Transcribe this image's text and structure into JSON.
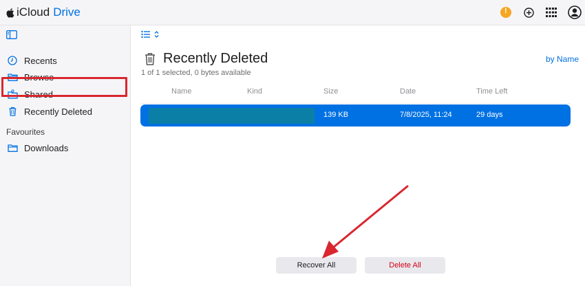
{
  "app": {
    "brand_name": "iCloud",
    "product_name": "Drive"
  },
  "topbar": {
    "icons": [
      "alert-icon",
      "add-icon",
      "app-grid-icon",
      "account-icon"
    ],
    "alert_glyph": "!",
    "alert_color": "#f5a623"
  },
  "sidebar": {
    "items": [
      {
        "label": "Recents",
        "icon": "clock-icon"
      },
      {
        "label": "Browse",
        "icon": "folder-icon"
      },
      {
        "label": "Shared",
        "icon": "shared-folder-icon"
      },
      {
        "label": "Recently Deleted",
        "icon": "trash-icon",
        "selected": true
      }
    ],
    "section_favourites": "Favourites",
    "favourites": [
      {
        "label": "Downloads",
        "icon": "folder-icon"
      }
    ]
  },
  "main": {
    "title": "Recently Deleted",
    "subtitle": "1 of 1 selected, 0 bytes available",
    "sort_label": "by Name",
    "columns": [
      "Name",
      "Kind",
      "Size",
      "Date",
      "Time Left"
    ],
    "rows": [
      {
        "name": "",
        "kind": "",
        "size": "139 KB",
        "date": "7/8/2025, 11:24",
        "time_left": "29 days",
        "selected": true
      }
    ],
    "recover_all_label": "Recover All",
    "delete_all_label": "Delete All"
  },
  "colors": {
    "accent": "#0071e3",
    "annotation_red": "#d9262f",
    "danger_text": "#d70015"
  }
}
